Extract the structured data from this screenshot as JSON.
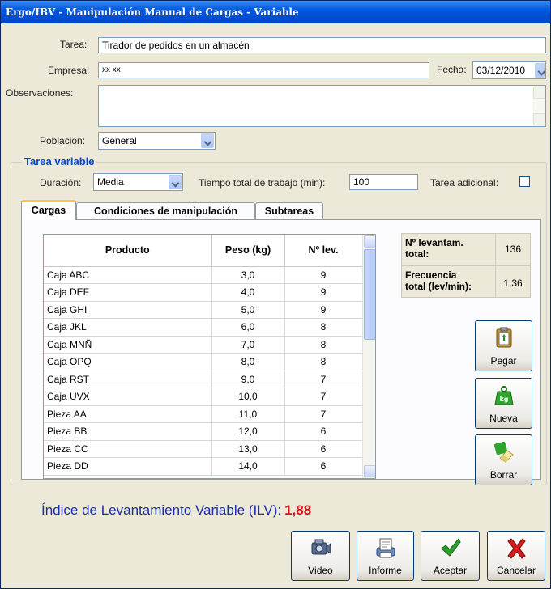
{
  "window": {
    "title": "Ergo/IBV - Manipulación Manual de Cargas - Variable"
  },
  "form": {
    "tarea_label": "Tarea:",
    "tarea_value": "Tirador de pedidos en un almacén",
    "empresa_label": "Empresa:",
    "empresa_value": "xx xx",
    "fecha_label": "Fecha:",
    "fecha_value": "03/12/2010",
    "observaciones_label": "Observaciones:",
    "observaciones_value": "",
    "poblacion_label": "Población:",
    "poblacion_value": "General"
  },
  "tarea_variable": {
    "title": "Tarea variable",
    "duracion_label": "Duración:",
    "duracion_value": "Media",
    "tiempo_label": "Tiempo total de trabajo (min):",
    "tiempo_value": "100",
    "adicional_label": "Tarea adicional:",
    "adicional_checked": false
  },
  "tabs": [
    {
      "label": "Cargas",
      "active": true
    },
    {
      "label": "Condiciones de manipulación",
      "active": false
    },
    {
      "label": "Subtareas",
      "active": false
    }
  ],
  "table": {
    "headers": [
      "Producto",
      "Peso (kg)",
      "Nº lev."
    ],
    "rows": [
      [
        "Caja ABC",
        "3,0",
        "9"
      ],
      [
        "Caja DEF",
        "4,0",
        "9"
      ],
      [
        "Caja GHI",
        "5,0",
        "9"
      ],
      [
        "Caja JKL",
        "6,0",
        "8"
      ],
      [
        "Caja MNÑ",
        "7,0",
        "8"
      ],
      [
        "Caja OPQ",
        "8,0",
        "8"
      ],
      [
        "Caja RST",
        "9,0",
        "7"
      ],
      [
        "Caja UVX",
        "10,0",
        "7"
      ],
      [
        "Pieza AA",
        "11,0",
        "7"
      ],
      [
        "Pieza BB",
        "12,0",
        "6"
      ],
      [
        "Pieza CC",
        "13,0",
        "6"
      ],
      [
        "Pieza DD",
        "14,0",
        "6"
      ]
    ]
  },
  "summary": {
    "levantam_label_1": "Nº levantam.",
    "levantam_label_2": "total:",
    "levantam_value": "136",
    "frecuencia_label_1": "Frecuencia",
    "frecuencia_label_2": "total (lev/min):",
    "frecuencia_value": "1,36"
  },
  "side_buttons": {
    "pegar": "Pegar",
    "nueva": "Nueva",
    "borrar": "Borrar"
  },
  "ilv": {
    "label": "Índice de Levantamiento Variable (ILV):",
    "value": "1,88"
  },
  "bottom_buttons": {
    "video": "Video",
    "informe": "Informe",
    "aceptar": "Aceptar",
    "cancelar": "Cancelar"
  },
  "icons": [
    "video-camera-icon",
    "report-icon",
    "checkmark-icon",
    "cross-icon",
    "clipboard-paste-icon",
    "weight-kg-icon",
    "eraser-icon"
  ],
  "colors": {
    "title_bar": "#0046c8",
    "group_title": "#0046d5",
    "ilv_label": "#1a2fa8",
    "ilv_value": "#d0141b",
    "active_tab_accent": "#ffc83c"
  }
}
